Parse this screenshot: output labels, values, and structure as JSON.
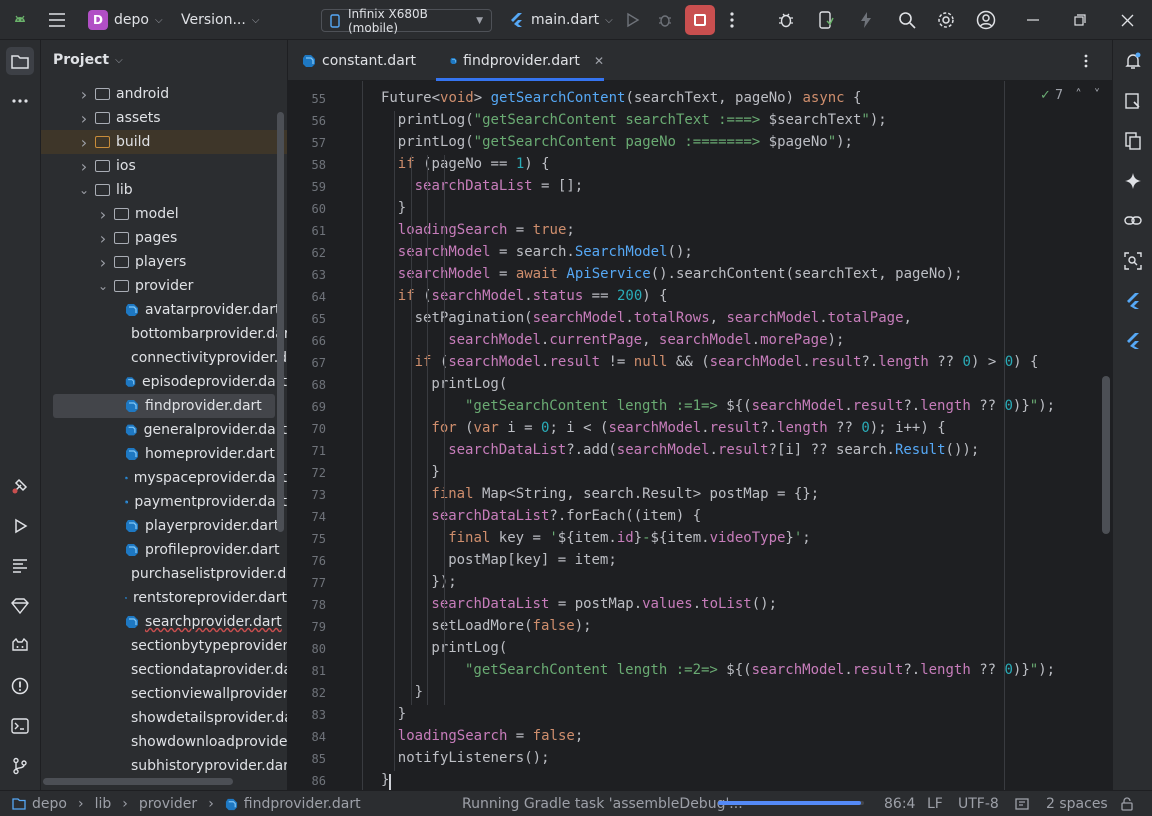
{
  "titlebar": {
    "project_letter": "D",
    "project_name": "depo",
    "vcs": "Version...",
    "device": "Infinix X680B (mobile)",
    "run_config": "main.dart"
  },
  "project_panel": {
    "title": "Project",
    "tree": [
      {
        "label": "android",
        "kind": "folder",
        "depth": 1,
        "expanded": false
      },
      {
        "label": "assets",
        "kind": "folder",
        "depth": 1,
        "expanded": false
      },
      {
        "label": "build",
        "kind": "folder-excluded",
        "depth": 1,
        "expanded": false
      },
      {
        "label": "ios",
        "kind": "folder",
        "depth": 1,
        "expanded": false
      },
      {
        "label": "lib",
        "kind": "folder",
        "depth": 1,
        "expanded": true
      },
      {
        "label": "model",
        "kind": "folder",
        "depth": 2,
        "expanded": false
      },
      {
        "label": "pages",
        "kind": "folder",
        "depth": 2,
        "expanded": false
      },
      {
        "label": "players",
        "kind": "folder",
        "depth": 2,
        "expanded": false
      },
      {
        "label": "provider",
        "kind": "folder",
        "depth": 2,
        "expanded": true
      },
      {
        "label": "avatarprovider.dart",
        "kind": "dart",
        "depth": 3
      },
      {
        "label": "bottombarprovider.dart",
        "kind": "dart",
        "depth": 3
      },
      {
        "label": "connectivityprovider.dart",
        "kind": "dart",
        "depth": 3
      },
      {
        "label": "episodeprovider.dart",
        "kind": "dart",
        "depth": 3
      },
      {
        "label": "findprovider.dart",
        "kind": "dart",
        "depth": 3,
        "selected": true
      },
      {
        "label": "generalprovider.dart",
        "kind": "dart",
        "depth": 3
      },
      {
        "label": "homeprovider.dart",
        "kind": "dart",
        "depth": 3
      },
      {
        "label": "myspaceprovider.dart",
        "kind": "dart",
        "depth": 3
      },
      {
        "label": "paymentprovider.dart",
        "kind": "dart",
        "depth": 3
      },
      {
        "label": "playerprovider.dart",
        "kind": "dart",
        "depth": 3
      },
      {
        "label": "profileprovider.dart",
        "kind": "dart",
        "depth": 3
      },
      {
        "label": "purchaselistprovider.dart",
        "kind": "dart",
        "depth": 3
      },
      {
        "label": "rentstoreprovider.dart",
        "kind": "dart",
        "depth": 3
      },
      {
        "label": "searchprovider.dart",
        "kind": "dart",
        "depth": 3,
        "error": true
      },
      {
        "label": "sectionbytypeprovider.dart",
        "kind": "dart",
        "depth": 3
      },
      {
        "label": "sectiondataprovider.dart",
        "kind": "dart",
        "depth": 3
      },
      {
        "label": "sectionviewallprovider.dart",
        "kind": "dart",
        "depth": 3
      },
      {
        "label": "showdetailsprovider.dart",
        "kind": "dart",
        "depth": 3
      },
      {
        "label": "showdownloadprovider.dart",
        "kind": "dart",
        "depth": 3
      },
      {
        "label": "subhistoryprovider.dart",
        "kind": "dart",
        "depth": 3
      }
    ]
  },
  "editor": {
    "tabs": [
      {
        "label": "constant.dart",
        "active": false
      },
      {
        "label": "findprovider.dart",
        "active": true
      }
    ],
    "inspection_count": "7",
    "lines": [
      {
        "n": "55",
        "indent": 0,
        "tokens": [
          [
            "typ",
            "Future<"
          ],
          [
            "kw",
            "void"
          ],
          [
            "typ",
            "> "
          ],
          [
            "fn",
            "getSearchContent"
          ],
          [
            "typ",
            "(searchText, pageNo) "
          ],
          [
            "kw",
            "async"
          ],
          [
            "typ",
            " {"
          ]
        ]
      },
      {
        "n": "56",
        "indent": 1,
        "tokens": [
          [
            "typ",
            "printLog("
          ],
          [
            "str",
            "\"getSearchContent searchText :===> "
          ],
          [
            "typ",
            "$searchText"
          ],
          [
            "str",
            "\""
          ],
          [
            "typ",
            ");"
          ]
        ]
      },
      {
        "n": "57",
        "indent": 1,
        "tokens": [
          [
            "typ",
            "printLog("
          ],
          [
            "str",
            "\"getSearchContent pageNo :=======> "
          ],
          [
            "typ",
            "$pageNo"
          ],
          [
            "str",
            "\""
          ],
          [
            "typ",
            ");"
          ]
        ]
      },
      {
        "n": "58",
        "indent": 1,
        "tokens": [
          [
            "kw",
            "if"
          ],
          [
            "typ",
            " (pageNo == "
          ],
          [
            "num",
            "1"
          ],
          [
            "typ",
            ") {"
          ]
        ]
      },
      {
        "n": "59",
        "indent": 2,
        "tokens": [
          [
            "fld",
            "searchDataList"
          ],
          [
            "typ",
            " = [];"
          ]
        ]
      },
      {
        "n": "60",
        "indent": 1,
        "tokens": [
          [
            "typ",
            "}"
          ]
        ]
      },
      {
        "n": "61",
        "indent": 1,
        "tokens": [
          [
            "fld",
            "loadingSearch"
          ],
          [
            "typ",
            " = "
          ],
          [
            "kw",
            "true"
          ],
          [
            "typ",
            ";"
          ]
        ]
      },
      {
        "n": "62",
        "indent": 1,
        "tokens": [
          [
            "fld",
            "searchModel"
          ],
          [
            "typ",
            " = search."
          ],
          [
            "fn",
            "SearchModel"
          ],
          [
            "typ",
            "();"
          ]
        ]
      },
      {
        "n": "63",
        "indent": 1,
        "tokens": [
          [
            "fld",
            "searchModel"
          ],
          [
            "typ",
            " = "
          ],
          [
            "kw",
            "await"
          ],
          [
            "typ",
            " "
          ],
          [
            "fn",
            "ApiService"
          ],
          [
            "typ",
            "().searchContent(searchText, pageNo);"
          ]
        ]
      },
      {
        "n": "64",
        "indent": 1,
        "tokens": [
          [
            "kw",
            "if"
          ],
          [
            "typ",
            " ("
          ],
          [
            "fld",
            "searchModel"
          ],
          [
            "typ",
            "."
          ],
          [
            "fld",
            "status"
          ],
          [
            "typ",
            " == "
          ],
          [
            "num",
            "200"
          ],
          [
            "typ",
            ") {"
          ]
        ]
      },
      {
        "n": "65",
        "indent": 2,
        "tokens": [
          [
            "typ",
            "setPagination("
          ],
          [
            "fld",
            "searchModel"
          ],
          [
            "typ",
            "."
          ],
          [
            "fld",
            "totalRows"
          ],
          [
            "typ",
            ", "
          ],
          [
            "fld",
            "searchModel"
          ],
          [
            "typ",
            "."
          ],
          [
            "fld",
            "totalPage"
          ],
          [
            "typ",
            ","
          ]
        ]
      },
      {
        "n": "66",
        "indent": 4,
        "tokens": [
          [
            "fld",
            "searchModel"
          ],
          [
            "typ",
            "."
          ],
          [
            "fld",
            "currentPage"
          ],
          [
            "typ",
            ", "
          ],
          [
            "fld",
            "searchModel"
          ],
          [
            "typ",
            "."
          ],
          [
            "fld",
            "morePage"
          ],
          [
            "typ",
            ");"
          ]
        ]
      },
      {
        "n": "67",
        "indent": 2,
        "tokens": [
          [
            "kw",
            "if"
          ],
          [
            "typ",
            " ("
          ],
          [
            "fld",
            "searchModel"
          ],
          [
            "typ",
            "."
          ],
          [
            "fld",
            "result"
          ],
          [
            "typ",
            " != "
          ],
          [
            "kw",
            "null"
          ],
          [
            "typ",
            " && ("
          ],
          [
            "fld",
            "searchModel"
          ],
          [
            "typ",
            "."
          ],
          [
            "fld",
            "result"
          ],
          [
            "typ",
            "?."
          ],
          [
            "fld",
            "length"
          ],
          [
            "typ",
            " ?? "
          ],
          [
            "num",
            "0"
          ],
          [
            "typ",
            ") > "
          ],
          [
            "num",
            "0"
          ],
          [
            "typ",
            ") {"
          ]
        ]
      },
      {
        "n": "68",
        "indent": 3,
        "tokens": [
          [
            "typ",
            "printLog("
          ]
        ]
      },
      {
        "n": "69",
        "indent": 5,
        "tokens": [
          [
            "str",
            "\"getSearchContent length :=1=> "
          ],
          [
            "typ",
            "${("
          ],
          [
            "fld",
            "searchModel"
          ],
          [
            "typ",
            "."
          ],
          [
            "fld",
            "result"
          ],
          [
            "typ",
            "?."
          ],
          [
            "fld",
            "length"
          ],
          [
            "typ",
            " ?? "
          ],
          [
            "num",
            "0"
          ],
          [
            "typ",
            ")}"
          ],
          [
            "str",
            "\""
          ],
          [
            "typ",
            ");"
          ]
        ]
      },
      {
        "n": "70",
        "indent": 3,
        "tokens": [
          [
            "kw",
            "for"
          ],
          [
            "typ",
            " ("
          ],
          [
            "kw",
            "var"
          ],
          [
            "typ",
            " i = "
          ],
          [
            "num",
            "0"
          ],
          [
            "typ",
            "; i < ("
          ],
          [
            "fld",
            "searchModel"
          ],
          [
            "typ",
            "."
          ],
          [
            "fld",
            "result"
          ],
          [
            "typ",
            "?."
          ],
          [
            "fld",
            "length"
          ],
          [
            "typ",
            " ?? "
          ],
          [
            "num",
            "0"
          ],
          [
            "typ",
            "); i++) {"
          ]
        ]
      },
      {
        "n": "71",
        "indent": 4,
        "tokens": [
          [
            "fld",
            "searchDataList"
          ],
          [
            "typ",
            "?.add("
          ],
          [
            "fld",
            "searchModel"
          ],
          [
            "typ",
            "."
          ],
          [
            "fld",
            "result"
          ],
          [
            "typ",
            "?[i] ?? search."
          ],
          [
            "fn",
            "Result"
          ],
          [
            "typ",
            "());"
          ]
        ]
      },
      {
        "n": "72",
        "indent": 3,
        "tokens": [
          [
            "typ",
            "}"
          ]
        ]
      },
      {
        "n": "73",
        "indent": 3,
        "tokens": [
          [
            "kw",
            "final"
          ],
          [
            "typ",
            " Map<String, search.Result> postMap = {};"
          ]
        ]
      },
      {
        "n": "74",
        "indent": 3,
        "tokens": [
          [
            "fld",
            "searchDataList"
          ],
          [
            "typ",
            "?.forEach((item) {"
          ]
        ]
      },
      {
        "n": "75",
        "indent": 4,
        "tokens": [
          [
            "kw",
            "final"
          ],
          [
            "typ",
            " key = "
          ],
          [
            "str",
            "'"
          ],
          [
            "typ",
            "${item."
          ],
          [
            "fld",
            "id"
          ],
          [
            "typ",
            "}"
          ],
          [
            "str",
            "-"
          ],
          [
            "typ",
            "${item."
          ],
          [
            "fld",
            "videoType"
          ],
          [
            "typ",
            "}"
          ],
          [
            "str",
            "'"
          ],
          [
            "typ",
            ";"
          ]
        ]
      },
      {
        "n": "76",
        "indent": 4,
        "tokens": [
          [
            "typ",
            "postMap[key] = item;"
          ]
        ]
      },
      {
        "n": "77",
        "indent": 3,
        "tokens": [
          [
            "typ",
            "});"
          ]
        ]
      },
      {
        "n": "78",
        "indent": 3,
        "tokens": [
          [
            "fld",
            "searchDataList"
          ],
          [
            "typ",
            " = postMap."
          ],
          [
            "fld",
            "values"
          ],
          [
            "typ",
            "."
          ],
          [
            "fld",
            "toList"
          ],
          [
            "typ",
            "();"
          ]
        ]
      },
      {
        "n": "79",
        "indent": 3,
        "tokens": [
          [
            "typ",
            "setLoadMore("
          ],
          [
            "kw",
            "false"
          ],
          [
            "typ",
            ");"
          ]
        ]
      },
      {
        "n": "80",
        "indent": 3,
        "tokens": [
          [
            "typ",
            "printLog("
          ]
        ]
      },
      {
        "n": "81",
        "indent": 5,
        "tokens": [
          [
            "str",
            "\"getSearchContent length :=2=> "
          ],
          [
            "typ",
            "${("
          ],
          [
            "fld",
            "searchModel"
          ],
          [
            "typ",
            "."
          ],
          [
            "fld",
            "result"
          ],
          [
            "typ",
            "?."
          ],
          [
            "fld",
            "length"
          ],
          [
            "typ",
            " ?? "
          ],
          [
            "num",
            "0"
          ],
          [
            "typ",
            ")}"
          ],
          [
            "str",
            "\""
          ],
          [
            "typ",
            ");"
          ]
        ]
      },
      {
        "n": "82",
        "indent": 2,
        "tokens": [
          [
            "typ",
            "}"
          ]
        ]
      },
      {
        "n": "83",
        "indent": 1,
        "tokens": [
          [
            "typ",
            "}"
          ]
        ]
      },
      {
        "n": "84",
        "indent": 1,
        "tokens": [
          [
            "fld",
            "loadingSearch"
          ],
          [
            "typ",
            " = "
          ],
          [
            "kw",
            "false"
          ],
          [
            "typ",
            ";"
          ]
        ]
      },
      {
        "n": "85",
        "indent": 1,
        "tokens": [
          [
            "typ",
            "notifyListeners();"
          ]
        ]
      },
      {
        "n": "86",
        "indent": 0,
        "tokens": [
          [
            "typ",
            "}"
          ]
        ]
      }
    ]
  },
  "statusbar": {
    "breadcrumb": [
      "depo",
      "lib",
      "provider",
      "findprovider.dart"
    ],
    "task": "Running Gradle task 'assembleDebug'...",
    "progress": 0.98,
    "position": "86:4",
    "line_sep": "LF",
    "encoding": "UTF-8",
    "indent": "2 spaces"
  },
  "colors": {
    "accent": "#3574f0",
    "keyword": "#cf8e6d",
    "function": "#56a8f5",
    "string": "#6aab73",
    "number": "#2aacb8",
    "field": "#c77dbb",
    "stop": "#c94f4f"
  }
}
